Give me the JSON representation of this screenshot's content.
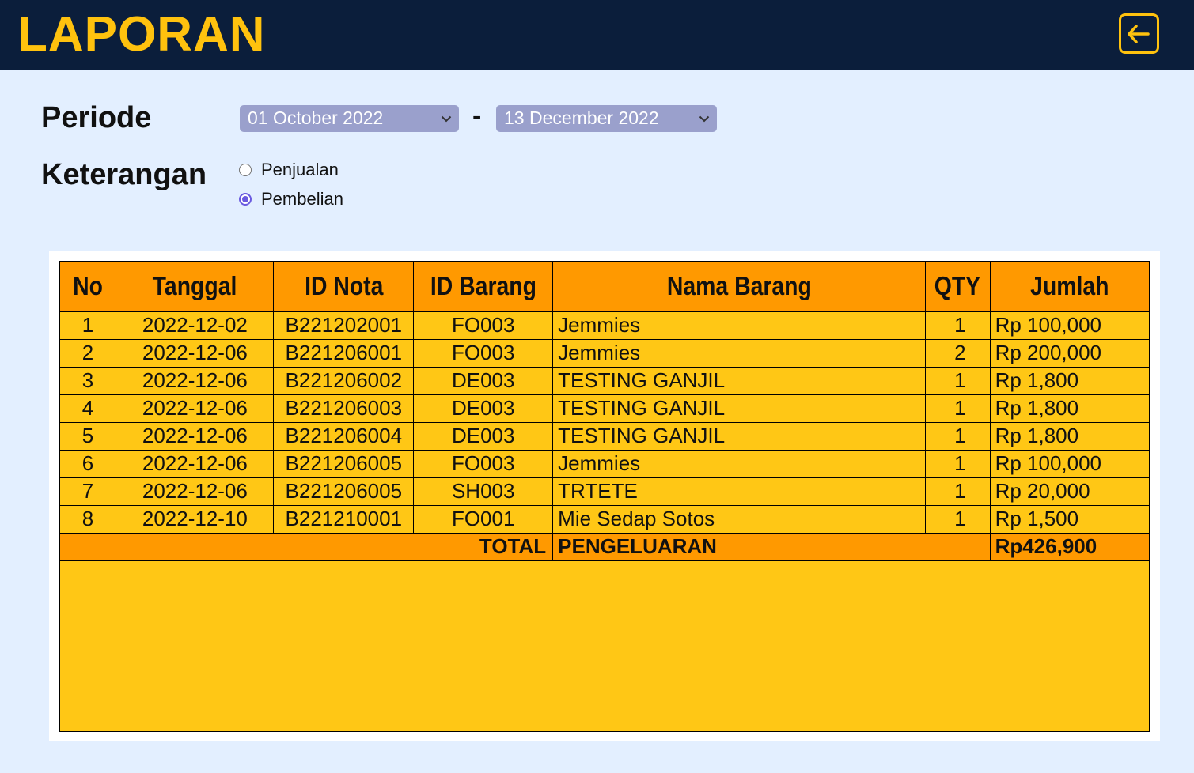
{
  "header": {
    "title": "LAPORAN",
    "back_icon": "back-arrow-icon"
  },
  "filter": {
    "periode_label": "Periode",
    "start_date": "01 October 2022",
    "separator": "-",
    "end_date": "13 December 2022",
    "keterangan_label": "Keterangan",
    "options": [
      {
        "label": "Penjualan",
        "checked": false
      },
      {
        "label": "Pembelian",
        "checked": true
      }
    ]
  },
  "table": {
    "columns": [
      "No",
      "Tanggal",
      "ID Nota",
      "ID Barang",
      "Nama Barang",
      "QTY",
      "Jumlah"
    ],
    "rows": [
      [
        "1",
        "2022-12-02",
        "B221202001",
        "FO003",
        "Jemmies",
        "1",
        "Rp 100,000"
      ],
      [
        "2",
        "2022-12-06",
        "B221206001",
        "FO003",
        "Jemmies",
        "2",
        "Rp 200,000"
      ],
      [
        "3",
        "2022-12-06",
        "B221206002",
        "DE003",
        "TESTING GANJIL",
        "1",
        "Rp 1,800"
      ],
      [
        "4",
        "2022-12-06",
        "B221206003",
        "DE003",
        "TESTING GANJIL",
        "1",
        "Rp 1,800"
      ],
      [
        "5",
        "2022-12-06",
        "B221206004",
        "DE003",
        "TESTING GANJIL",
        "1",
        "Rp 1,800"
      ],
      [
        "6",
        "2022-12-06",
        "B221206005",
        "FO003",
        "Jemmies",
        "1",
        "Rp 100,000"
      ],
      [
        "7",
        "2022-12-06",
        "B221206005",
        "SH003",
        "TRTETE",
        "1",
        "Rp 20,000"
      ],
      [
        "8",
        "2022-12-10",
        "B221210001",
        "FO001",
        "Mie Sedap Sotos",
        "1",
        "Rp 1,500"
      ]
    ],
    "total_label_left": "TOTAL",
    "total_label_right": "PENGELUARAN",
    "total_value": "Rp426,900"
  },
  "colors": {
    "topbar": "#0b1e3b",
    "accent": "#ffc20e",
    "header_row": "#ff9900",
    "body_row": "#ffc715",
    "background": "#e3efff",
    "select": "#9aa0cc",
    "radio": "#6a5ae0"
  }
}
